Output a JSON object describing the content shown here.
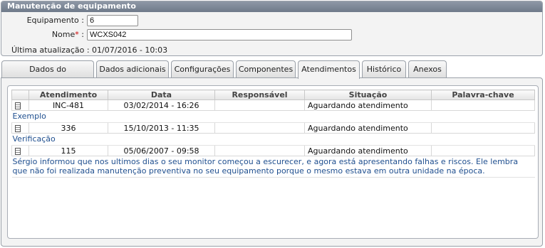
{
  "panel": {
    "title": "Manutenção de equipamento",
    "equipamento_label": "Equipamento :",
    "equipamento_value": "6",
    "nome_label": "Nome",
    "nome_required": "*",
    "nome_sep": ":",
    "nome_value": "WCXS042",
    "updated_text": "Última atualização : 01/07/2016 - 10:03"
  },
  "tabs": [
    {
      "label": "Dados do equipamento"
    },
    {
      "label": "Dados adicionais"
    },
    {
      "label": "Configurações"
    },
    {
      "label": "Componentes"
    },
    {
      "label": "Atendimentos"
    },
    {
      "label": "Histórico"
    },
    {
      "label": "Anexos"
    }
  ],
  "active_tab": "Atendimentos",
  "grid": {
    "columns": [
      "Atendimento",
      "Data",
      "Responsável",
      "Situação",
      "Palavra-chave"
    ],
    "rows": [
      {
        "atendimento": "INC-481",
        "data": "03/02/2014 - 16:26",
        "responsavel": "",
        "situacao": "Aguardando atendimento",
        "palavra": "",
        "note": "Exemplo"
      },
      {
        "atendimento": "336",
        "data": "15/10/2013 - 11:35",
        "responsavel": "",
        "situacao": "Aguardando atendimento",
        "palavra": "",
        "note": "Verificação"
      },
      {
        "atendimento": "115",
        "data": "05/06/2007 - 09:58",
        "responsavel": "",
        "situacao": "Aguardando atendimento",
        "palavra": "",
        "note": "Sérgio informou que nos ultimos dias o seu monitor começou a escurecer, e agora está apresentando falhas e riscos. Ele lembra que não foi realizada manutenção preventiva no seu equipamento porque o mesmo estava em outra unidade na época."
      }
    ]
  }
}
